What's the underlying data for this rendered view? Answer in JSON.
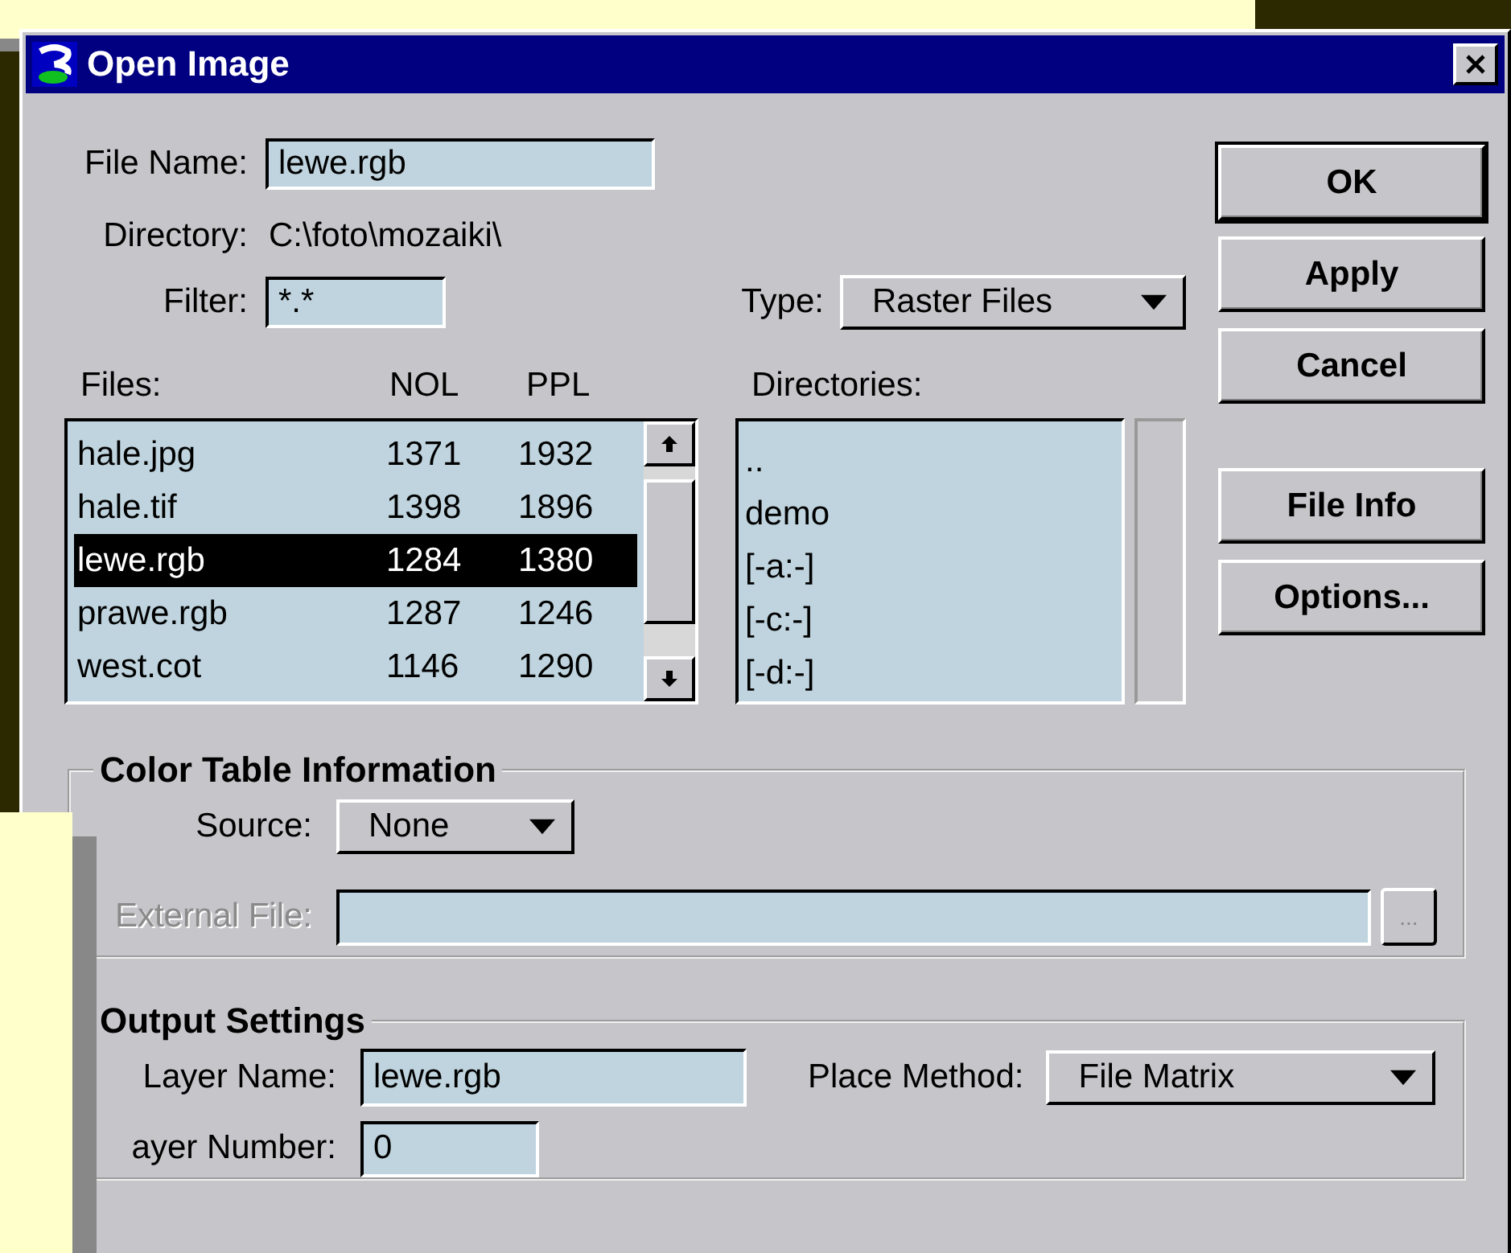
{
  "window": {
    "title": "Open Image"
  },
  "file_name": {
    "label": "File Name:",
    "value": "lewe.rgb"
  },
  "directory": {
    "label": "Directory:",
    "value": "C:\\foto\\mozaiki\\"
  },
  "filter": {
    "label": "Filter:",
    "value": "*.*"
  },
  "type": {
    "label": "Type:",
    "value": "Raster Files"
  },
  "files": {
    "label": "Files:",
    "columns": [
      "NOL",
      "PPL"
    ],
    "rows": [
      {
        "name": "hale.jpg",
        "nol": "1371",
        "ppl": "1932",
        "selected": false
      },
      {
        "name": "hale.tif",
        "nol": "1398",
        "ppl": "1896",
        "selected": false
      },
      {
        "name": "lewe.rgb",
        "nol": "1284",
        "ppl": "1380",
        "selected": true
      },
      {
        "name": "prawe.rgb",
        "nol": "1287",
        "ppl": "1246",
        "selected": false
      },
      {
        "name": "west.cot",
        "nol": "1146",
        "ppl": "1290",
        "selected": false
      }
    ]
  },
  "directories": {
    "label": "Directories:",
    "items": [
      {
        "name": "..",
        "selected": false
      },
      {
        "name": "demo",
        "selected": false
      },
      {
        "name": "[-a:-]",
        "selected": false
      },
      {
        "name": "[-c:-]",
        "selected": false
      },
      {
        "name": "[-d:-]",
        "selected": false
      }
    ]
  },
  "buttons": [
    {
      "label": "OK",
      "default": true
    },
    {
      "label": "Apply",
      "default": false
    },
    {
      "label": "Cancel",
      "default": false
    },
    {
      "label": "File Info",
      "default": false
    },
    {
      "label": "Options...",
      "default": false
    }
  ],
  "color_table": {
    "title": "Color Table Information",
    "source": {
      "label": "Source:",
      "value": "None"
    },
    "external_file": {
      "label": "External File:",
      "disabled": true
    },
    "browse_label": "..."
  },
  "output_settings": {
    "title": "Output Settings",
    "layer_name": {
      "label": "Layer Name:",
      "value": "lewe.rgb"
    },
    "place_method": {
      "label": "Place Method:",
      "value": "File Matrix"
    },
    "layer_number": {
      "label": "ayer Number:",
      "value": "0"
    }
  }
}
